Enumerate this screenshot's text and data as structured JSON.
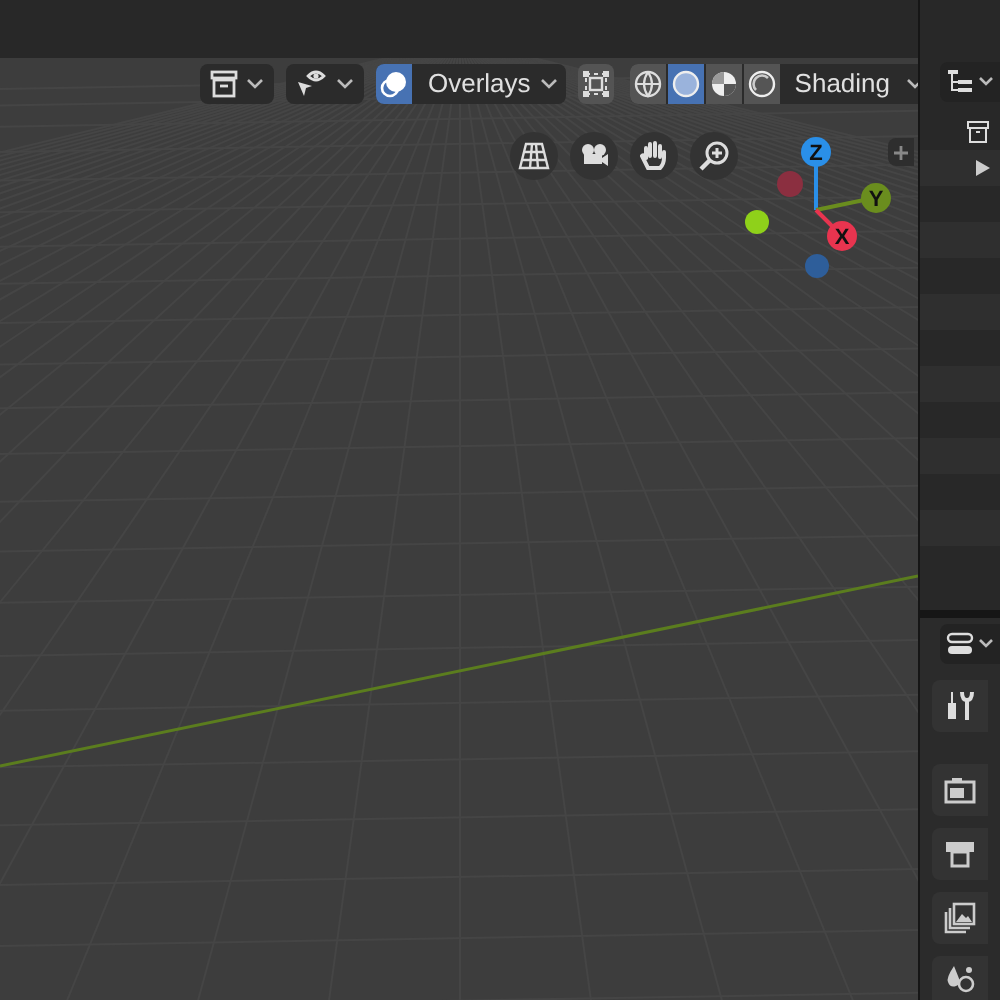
{
  "header": {
    "overlays": {
      "label": "Overlays",
      "on": true
    },
    "xray": {
      "on": false
    },
    "shading": {
      "label": "Shading",
      "modes": [
        {
          "kind": "wireframe",
          "selected": false
        },
        {
          "kind": "solid",
          "selected": true
        },
        {
          "kind": "material",
          "selected": false
        },
        {
          "kind": "rendered",
          "selected": false
        }
      ]
    }
  },
  "gizmo": {
    "axes": [
      {
        "label": "Z"
      },
      {
        "label": "Y"
      },
      {
        "label": "X"
      }
    ]
  }
}
